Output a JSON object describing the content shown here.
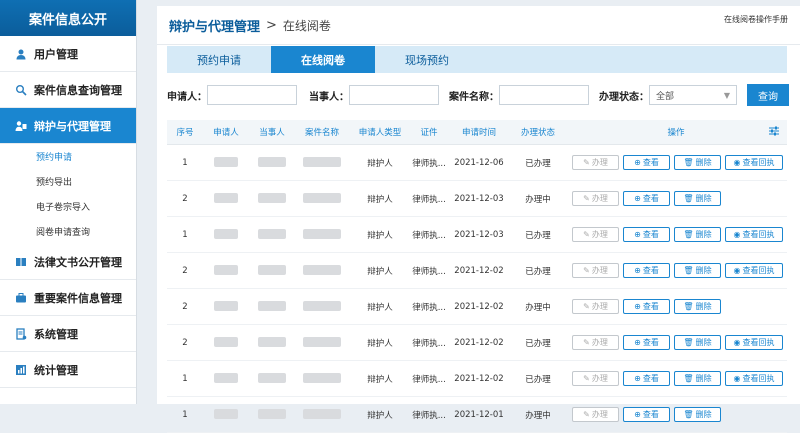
{
  "sidebar": {
    "brand": "案件信息公开",
    "items": [
      {
        "label": "用户管理",
        "icon": "user-icon"
      },
      {
        "label": "案件信息查询管理",
        "icon": "search-case-icon"
      },
      {
        "label": "辩护与代理管理",
        "icon": "lawyer-icon",
        "active": true
      },
      {
        "label": "法律文书公开管理",
        "icon": "book-icon"
      },
      {
        "label": "重要案件信息管理",
        "icon": "briefcase-icon"
      },
      {
        "label": "系统管理",
        "icon": "settings-doc-icon"
      },
      {
        "label": "统计管理",
        "icon": "stats-icon"
      }
    ],
    "subitems": [
      "预约申请",
      "预约导出",
      "电子卷宗导入",
      "阅卷申请查询"
    ]
  },
  "header": {
    "title": "辩护与代理管理",
    "separator": ">",
    "subtitle": "在线阅卷",
    "help": "在线阅卷操作手册"
  },
  "tabs": [
    "预约申请",
    "在线阅卷",
    "现场预约"
  ],
  "filters": {
    "applicant_label": "申请人：",
    "party_label": "当事人：",
    "case_label": "案件名称：",
    "status_label": "办理状态：",
    "status_value": "全部",
    "query_label": "查询"
  },
  "table": {
    "headers": [
      "序号",
      "申请人",
      "当事人",
      "案件名称",
      "申请人类型",
      "证件",
      "申请时间",
      "办理状态",
      "操作"
    ],
    "rows": [
      {
        "no": "1",
        "type": "辩护人",
        "cert": "律师执...",
        "date": "2021-12-06",
        "status": "已办理",
        "receipt": true
      },
      {
        "no": "2",
        "type": "辩护人",
        "cert": "律师执...",
        "date": "2021-12-03",
        "status": "办理中",
        "receipt": false
      },
      {
        "no": "1",
        "type": "辩护人",
        "cert": "律师执...",
        "date": "2021-12-03",
        "status": "已办理",
        "receipt": true
      },
      {
        "no": "2",
        "type": "辩护人",
        "cert": "律师执...",
        "date": "2021-12-02",
        "status": "已办理",
        "receipt": true
      },
      {
        "no": "2",
        "type": "辩护人",
        "cert": "律师执...",
        "date": "2021-12-02",
        "status": "办理中",
        "receipt": false
      },
      {
        "no": "2",
        "type": "辩护人",
        "cert": "律师执...",
        "date": "2021-12-02",
        "status": "已办理",
        "receipt": true
      },
      {
        "no": "1",
        "type": "辩护人",
        "cert": "律师执...",
        "date": "2021-12-02",
        "status": "已办理",
        "receipt": true
      },
      {
        "no": "1",
        "type": "辩护人",
        "cert": "律师执...",
        "date": "2021-12-01",
        "status": "办理中",
        "receipt": false
      }
    ],
    "ops": {
      "handle": "办理",
      "view": "查看",
      "delete": "删除",
      "receipt": "查看回执"
    }
  }
}
